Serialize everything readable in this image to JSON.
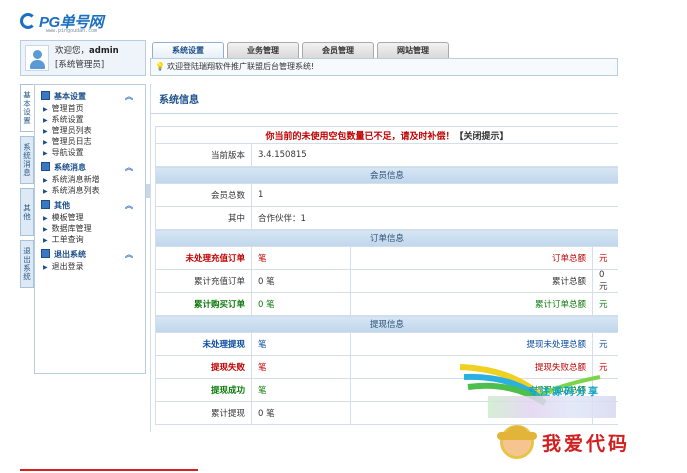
{
  "logo": {
    "text": "PG单号网",
    "subtext": "www.pingoudan.com"
  },
  "user": {
    "greeting": "欢迎您，",
    "name": "admin",
    "role": "[系统管理员]"
  },
  "vertical_tabs": [
    "基本设置",
    "系统消息",
    "其他",
    "退出系统"
  ],
  "menu": {
    "groups": [
      {
        "title": "基本设置",
        "items": [
          "管理首页",
          "系统设置",
          "管理员列表",
          "管理员日志",
          "导航设置"
        ]
      },
      {
        "title": "系统消息",
        "items": [
          "系统消息新增",
          "系统消息列表"
        ]
      },
      {
        "title": "其他",
        "items": [
          "模板管理",
          "数据库管理",
          "工单查询"
        ]
      },
      {
        "title": "退出系统",
        "items": [
          "退出登录"
        ]
      }
    ],
    "collapse_glyph": "︽"
  },
  "tabs": [
    "系统设置",
    "业务管理",
    "会员管理",
    "网站管理"
  ],
  "notice": "欢迎登陆瑞翔软件推广联盟后台管理系统!",
  "main": {
    "title": "系统信息",
    "alert": "你当前的未使用空包数量已不足，请及时补偿！",
    "alert_close": "【关闭提示】",
    "version_label": "当前版本",
    "version": "3.4.150815",
    "section_members": "会员信息",
    "member_total_label": "会员总数",
    "member_total": "1",
    "member_other_label": "其中",
    "member_other": "合作伙伴：1",
    "section_orders": "订单信息",
    "unprocessed_recharge_label": "未处理充值订单",
    "unprocessed_recharge_val": "笔",
    "order_total_label": "订单总额",
    "order_total_val": "元",
    "cum_recharge_label": "累计充值订单",
    "cum_recharge_val": "0 笔",
    "cum_total_label": "累计总额",
    "cum_total_val": "0元",
    "cum_purchase_label": "累计购买订单",
    "cum_purchase_val": "0 笔",
    "cum_order_total_label": "累计订单总额",
    "cum_order_total_val": "元",
    "section_withdraw": "提现信息",
    "w_unprocessed_label": "未处理提现",
    "w_unprocessed_val": "笔",
    "w_unprocessed_total_label": "提现未处理总额",
    "w_unprocessed_total_val": "元",
    "w_failed_label": "提现失败",
    "w_failed_val": "笔",
    "w_failed_total_label": "提现失败总额",
    "w_failed_total_val": "元",
    "w_success_label": "提现成功",
    "w_success_val": "笔",
    "w_success_total_label": "提现成功总额",
    "w_cum_label": "累计提现",
    "w_cum_val": "0 笔"
  },
  "watermark": {
    "line1": "专注源码分享",
    "line2": "我爱代码"
  },
  "colors": {
    "accent": "#1b4f8a",
    "alert": "#c00000",
    "success": "#0a7a0a",
    "section": "#c8dcf0"
  }
}
